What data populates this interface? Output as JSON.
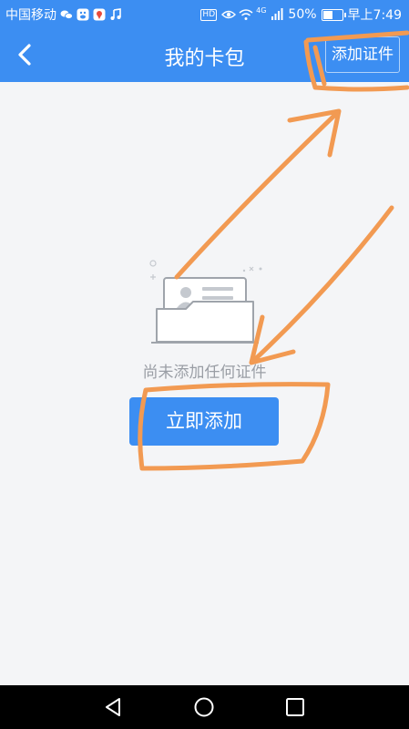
{
  "status_bar": {
    "carrier": "中国移动",
    "network": "4G",
    "battery_text": "50%",
    "battery_level": 0.5,
    "time": "早上7:49",
    "hd_badge": "HD",
    "icons": [
      "wechat-icon",
      "baidu-icon",
      "map-icon",
      "music-icon",
      "hd-icon",
      "eye-icon",
      "wifi-icon",
      "signal-icon",
      "battery-icon"
    ]
  },
  "header": {
    "title": "我的卡包",
    "back_icon": "chevron-left-icon",
    "add_button_label": "添加证件"
  },
  "empty_state": {
    "illustration": "card-holder-icon",
    "message": "尚未添加任何证件",
    "button_label": "立即添加"
  },
  "nav_bar": {
    "icons": [
      "back-triangle-icon",
      "home-circle-icon",
      "recents-square-icon"
    ]
  },
  "colors": {
    "primary": "#3c8ef2",
    "background": "#f4f5f7",
    "annotation": "#f29a52",
    "muted_text": "#9a9ea5"
  }
}
